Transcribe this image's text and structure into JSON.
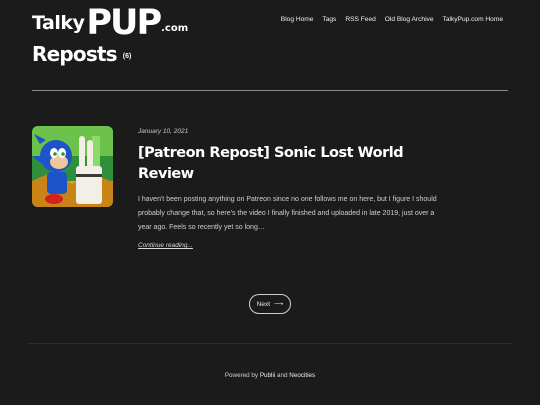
{
  "header": {
    "logo": {
      "part1": "Talky",
      "part2": "PUP",
      "part3": ".com"
    },
    "nav": [
      "Blog Home",
      "Tags",
      "RSS Feed",
      "Old Blog Archive",
      "TalkyPup.com Home"
    ]
  },
  "archive": {
    "title": "Reposts",
    "count": "(6)"
  },
  "post": {
    "date": "January 10, 2021",
    "title": "[Patreon Repost] Sonic Lost World Review",
    "excerpt": "I haven't been posting anything on Patreon since no one follows me on here, but I figure I should probably change that, so here's the video I finally finished and uploaded in late 2019, just over a year ago. Feels so recently yet so long…",
    "read_more": "Continue reading..."
  },
  "pagination": {
    "next": "Next",
    "arrow": "⟶"
  },
  "footer": {
    "prefix": "Powered by",
    "link1": "Publii",
    "and": "and",
    "link2": "Neocities"
  },
  "colors": {
    "background": "#1b1b1b",
    "text": "#e6e6e6"
  }
}
